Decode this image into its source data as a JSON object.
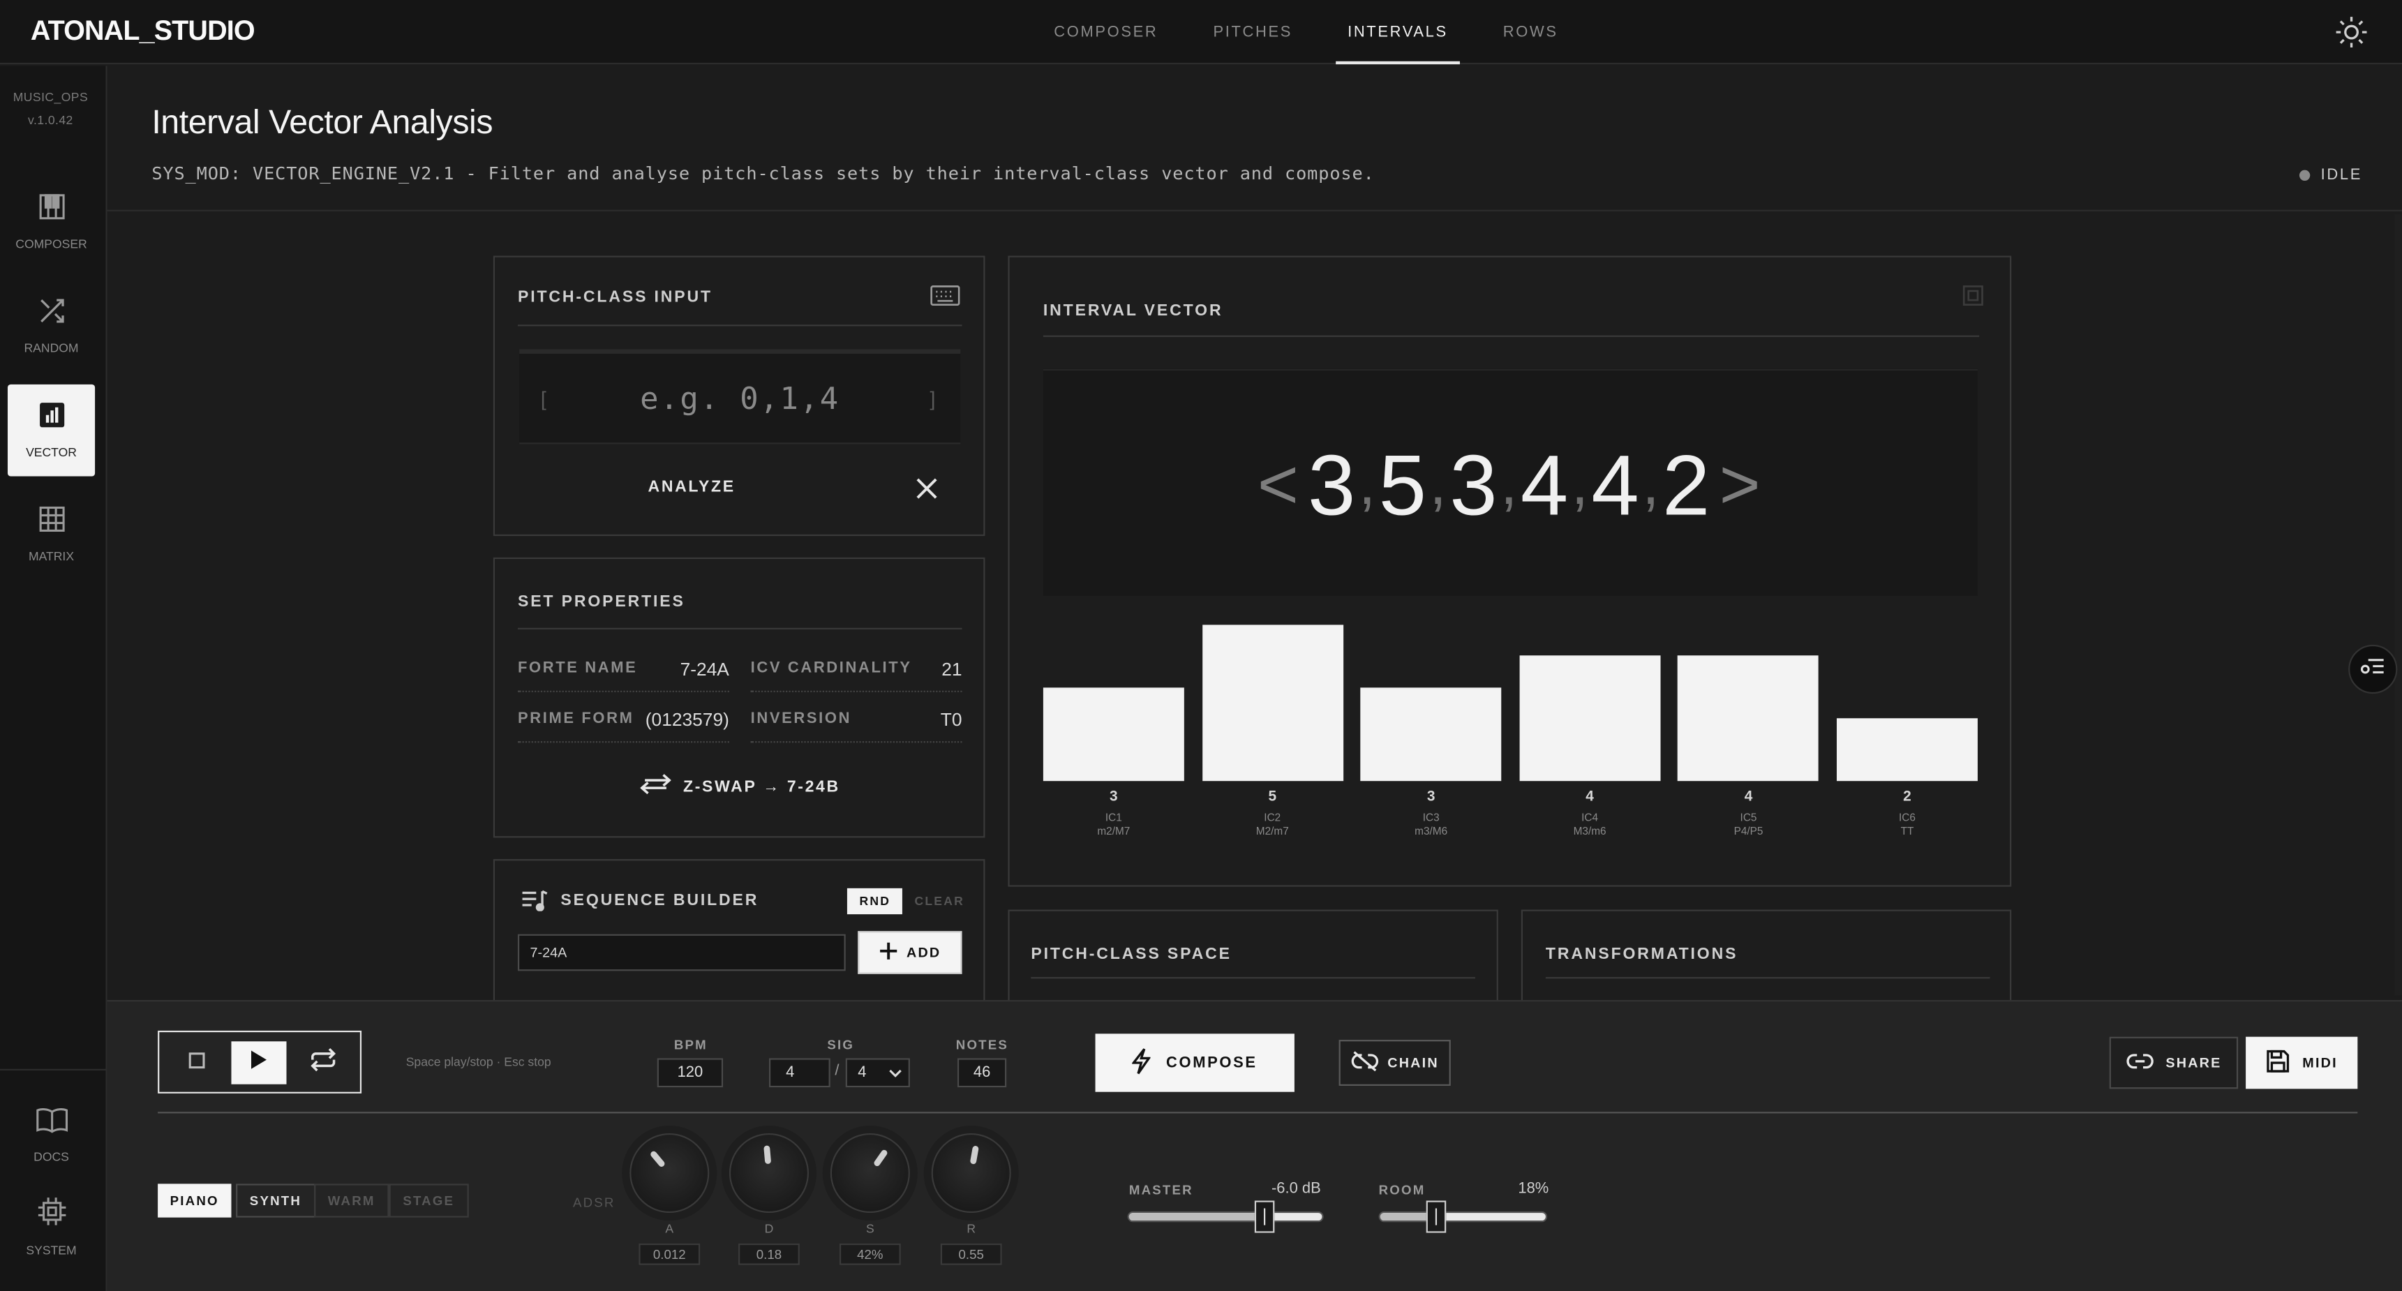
{
  "app": {
    "logo": "ATONAL_STUDIO"
  },
  "nav": {
    "tabs": [
      "COMPOSER",
      "PITCHES",
      "INTERVALS",
      "ROWS"
    ],
    "active": "INTERVALS"
  },
  "sidebar": {
    "brand": "MUSIC_OPS",
    "version": "v.1.0.42",
    "items": [
      {
        "label": "COMPOSER",
        "icon": "piano-icon"
      },
      {
        "label": "RANDOM",
        "icon": "shuffle-icon"
      },
      {
        "label": "VECTOR",
        "icon": "bar-chart-icon",
        "active": true
      },
      {
        "label": "MATRIX",
        "icon": "grid-icon"
      }
    ],
    "bottom": [
      {
        "label": "DOCS",
        "icon": "book-icon"
      },
      {
        "label": "SYSTEM",
        "icon": "chip-icon"
      }
    ]
  },
  "header": {
    "title": "Interval Vector Analysis",
    "subtitle": "SYS_MOD: VECTOR_ENGINE_V2.1 - Filter and analyse pitch-class sets by their interval-class vector and compose.",
    "status": "IDLE"
  },
  "pitch_input": {
    "title": "PITCH-CLASS INPUT",
    "placeholder": "e.g. 0,1,4",
    "bracket_open": "[",
    "bracket_close": "]",
    "analyze_label": "ANALYZE"
  },
  "set_properties": {
    "title": "SET PROPERTIES",
    "rows": [
      {
        "label": "FORTE NAME",
        "value": "7-24A"
      },
      {
        "label": "ICV CARDINALITY",
        "value": "21"
      },
      {
        "label": "PRIME FORM",
        "value": "(0123579)"
      },
      {
        "label": "INVERSION",
        "value": "T0"
      }
    ],
    "zswap_label": "Z-SWAP → 7-24B"
  },
  "sequence_builder": {
    "title": "SEQUENCE BUILDER",
    "rnd_label": "RND",
    "clear_label": "CLEAR",
    "input_value": "7-24A",
    "add_label": "ADD"
  },
  "interval_vector": {
    "title": "INTERVAL VECTOR",
    "open": "<",
    "close": ">",
    "values": [
      3,
      5,
      3,
      4,
      4,
      2
    ],
    "value_text": [
      "3",
      "5",
      "3",
      "4",
      "4",
      "2"
    ],
    "classes": [
      {
        "ic": "IC1",
        "sub": "m2/M7"
      },
      {
        "ic": "IC2",
        "sub": "M2/m7"
      },
      {
        "ic": "IC3",
        "sub": "m3/M6"
      },
      {
        "ic": "IC4",
        "sub": "M3/m6"
      },
      {
        "ic": "IC5",
        "sub": "P4/P5"
      },
      {
        "ic": "IC6",
        "sub": "TT"
      }
    ]
  },
  "panels": {
    "pitch_class_space": "PITCH-CLASS SPACE",
    "transformations": "TRANSFORMATIONS"
  },
  "transport": {
    "hint": "Space play/stop · Esc stop",
    "bpm_label": "BPM",
    "bpm": "120",
    "sig_label": "SIG",
    "sig_num": "4",
    "sig_sep": "/",
    "sig_den": "4",
    "notes_label": "NOTES",
    "notes": "46",
    "compose_label": "COMPOSE",
    "chain_label": "CHAIN",
    "share_label": "SHARE",
    "midi_label": "MIDI"
  },
  "sound": {
    "presets": [
      {
        "label": "PIANO",
        "active": true
      },
      {
        "label": "SYNTH",
        "active": false
      },
      {
        "label": "WARM",
        "active": false
      },
      {
        "label": "STAGE",
        "active": false
      }
    ],
    "adsr_label": "ADSR",
    "knobs": [
      {
        "label": "A",
        "value": "0.012"
      },
      {
        "label": "D",
        "value": "0.18"
      },
      {
        "label": "S",
        "value": "42%"
      },
      {
        "label": "R",
        "value": "0.55"
      }
    ],
    "master_label": "MASTER",
    "master_value": "-6.0 dB",
    "master_level": 0.7,
    "room_label": "ROOM",
    "room_value": "18%",
    "room_level": 0.33
  },
  "colors": {
    "background": "#1c1c1c",
    "panel": "#1d1d1d",
    "accent": "#f3f3f3",
    "border": "#3a3a3a"
  }
}
